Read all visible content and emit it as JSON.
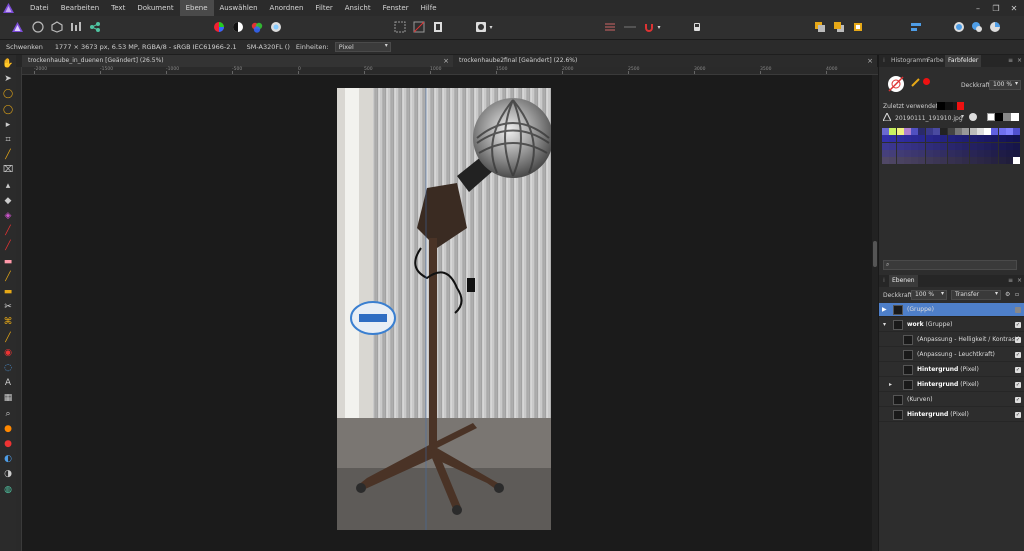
{
  "menu": {
    "items": [
      "Datei",
      "Bearbeiten",
      "Text",
      "Dokument",
      "Ebene",
      "Auswählen",
      "Anordnen",
      "Filter",
      "Ansicht",
      "Fenster",
      "Hilfe"
    ],
    "active": "Ebene"
  },
  "window_controls": [
    "minimize-icon",
    "restore-icon",
    "close-icon"
  ],
  "context": {
    "tool": "Schwenken",
    "image_info": "1777 × 3673 px, 6.53 MP, RGBA/8 - sRGB IEC61966-2.1",
    "camera": "SM-A320FL ()",
    "units_label": "Einheiten:",
    "units_value": "Pixel"
  },
  "tabs": [
    {
      "label": "trockenhaube_in_duenen [Geändert] (26.5%)",
      "close": "×"
    },
    {
      "label": "trockenhaube2final [Geändert] (22.6%)",
      "close": "×"
    }
  ],
  "ruler": {
    "ticks": [
      "-2000",
      "-1500",
      "-1000",
      "-500",
      "0",
      "500",
      "1000",
      "1500",
      "2000",
      "2500",
      "3000",
      "3500",
      "4000"
    ]
  },
  "panels": {
    "color_tabs": [
      "Histogramm",
      "Farbe",
      "Farbfelder"
    ],
    "active_color_tab": "Farbfelder",
    "opacity_label": "Deckkraft:",
    "opacity_value": "100 %",
    "recent_label": "Zuletzt verwendet:",
    "palette_name": "20190111_191910.jpg",
    "search_placeholder": "",
    "layers_tab": "Ebenen",
    "layers_opacity_label": "Deckkraft:",
    "layers_opacity_value": "100 %",
    "blend_mode": "Transfer"
  },
  "layers": [
    {
      "name": "(Gruppe)",
      "bold": "",
      "selected": true,
      "indent": 0,
      "arrow": ""
    },
    {
      "name": " (Gruppe)",
      "bold": "work",
      "selected": false,
      "indent": 0,
      "arrow": "▾"
    },
    {
      "name": "(Anpassung - Helligkeit / Kontrast)",
      "bold": "",
      "selected": false,
      "indent": 1,
      "arrow": ""
    },
    {
      "name": "(Anpassung - Leuchtkraft)",
      "bold": "",
      "selected": false,
      "indent": 1,
      "arrow": ""
    },
    {
      "name": " (Pixel)",
      "bold": "Hintergrund",
      "selected": false,
      "indent": 1,
      "arrow": ""
    },
    {
      "name": " (Pixel)",
      "bold": "Hintergrund",
      "selected": false,
      "indent": 1,
      "arrow": "▸"
    },
    {
      "name": "(Kurven)",
      "bold": "",
      "selected": false,
      "indent": 0,
      "arrow": ""
    },
    {
      "name": " (Pixel)",
      "bold": "Hintergrund",
      "selected": false,
      "indent": 0,
      "arrow": ""
    }
  ],
  "colors": {
    "accent": "#4e7fc9",
    "bg": "#1e1e1e",
    "panel": "#2d2d2d",
    "logo": "#7b4cd6"
  }
}
